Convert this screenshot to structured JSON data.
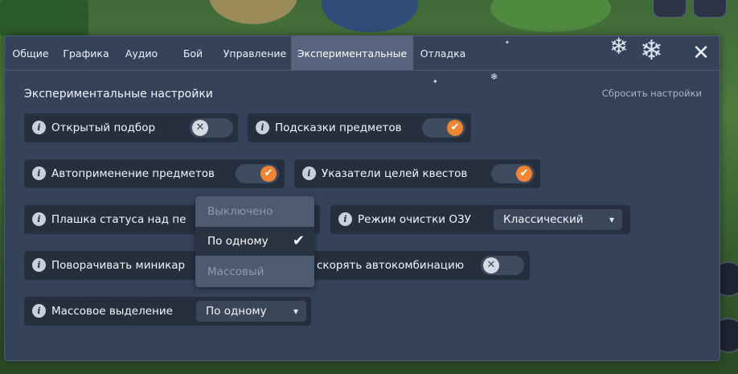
{
  "tabs": [
    {
      "label": "Общие"
    },
    {
      "label": "Графика"
    },
    {
      "label": "Аудио"
    },
    {
      "label": "Бой"
    },
    {
      "label": "Управление"
    },
    {
      "label": "Экспериментальные"
    },
    {
      "label": "Отладка"
    }
  ],
  "active_tab": "Экспериментальные",
  "section_title": "Экспериментальные настройки",
  "reset_label": "Сбросить настройки",
  "close_symbol": "✕",
  "settings": {
    "open_pickup": {
      "label": "Открытый подбор",
      "enabled": false
    },
    "item_hints": {
      "label": "Подсказки предметов",
      "enabled": true
    },
    "auto_apply": {
      "label": "Автоприменение предметов",
      "enabled": true
    },
    "quest_pointers": {
      "label": "Указатели целей квестов",
      "enabled": true
    },
    "status_bar": {
      "label": "Плашка статуса над пе"
    },
    "ram_mode": {
      "label": "Режим очистки ОЗУ",
      "value": "Классический"
    },
    "rotate_minimap": {
      "label": "Поворачивать миникар"
    },
    "speed_combo": {
      "label": "скорять автокомбинацию",
      "enabled": false
    },
    "mass_select": {
      "label": "Массовое выделение",
      "value": "По одному"
    }
  },
  "dropdown": {
    "options": [
      {
        "label": "Выключено",
        "state": "disabled"
      },
      {
        "label": "По одному",
        "state": "selected"
      },
      {
        "label": "Массовый",
        "state": "disabled"
      }
    ],
    "check_symbol": "✔"
  },
  "icons": {
    "info": "i",
    "check": "✔",
    "x": "✕",
    "chevron": "⌄"
  },
  "colors": {
    "panel_bg": "#34435a",
    "row_bg": "#262f3e",
    "toggle_on": "#f08532",
    "active_tab": "#56657d"
  }
}
